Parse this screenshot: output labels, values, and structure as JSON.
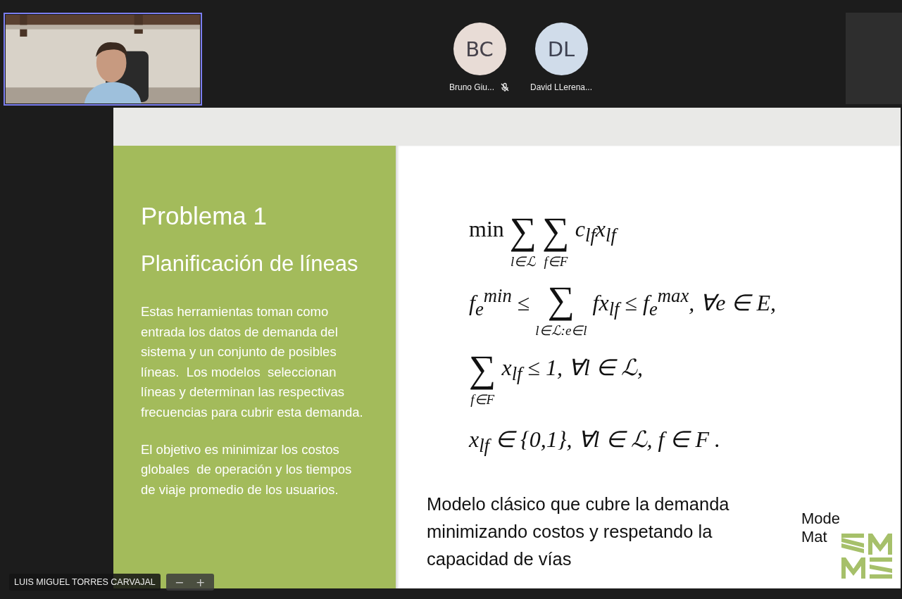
{
  "self_view": {
    "kind": "picture",
    "speaking": true
  },
  "participants": [
    {
      "initials": "BC",
      "name": "Bruno Giu...",
      "muted": true,
      "color": "#e8dcd6"
    },
    {
      "initials": "DL",
      "name": "David LLerena...",
      "muted": false,
      "color": "#d0dcea"
    }
  ],
  "slide": {
    "title": "Problema 1",
    "subtitle": "Planificación de líneas",
    "paragraphs": [
      "Estas herramientas toman como entrada los datos de demanda del sistema y un conjunto de posibles líneas.  Los modelos  seleccionan líneas y determinan las respectivas frecuencias para cubrir esta demanda.",
      "El objetivo es minimizar los costos globales  de operación y los tiempos de viaje promedio de los usuarios."
    ],
    "formulas": [
      [
        {
          "kind": "op",
          "text": "min"
        },
        {
          "kind": "sum",
          "symbol": "∑",
          "under": "l∈ℒ"
        },
        {
          "kind": "sum",
          "symbol": "∑",
          "under": "f∈F"
        },
        {
          "kind": "text",
          "text": "c$_{lf}$x$_{lf}$"
        }
      ],
      [
        {
          "kind": "text",
          "text": "f$_{e}$$^{min}$ ≤"
        },
        {
          "kind": "sum",
          "symbol": "∑",
          "under": "l∈ℒ:e∈l"
        },
        {
          "kind": "text",
          "text": "fx$_{lf}$ ≤ f$_{e}$$^{max}$, ∀e ∈ E,"
        }
      ],
      [
        {
          "kind": "sum",
          "symbol": "∑",
          "under": "f∈F"
        },
        {
          "kind": "text",
          "text": "x$_{lf}$ ≤ 1, ∀l ∈ ℒ,"
        }
      ],
      [
        {
          "kind": "text",
          "text": "x$_{lf}$ ∈ {0,1}, ∀l ∈ ℒ, f ∈ F ."
        }
      ]
    ],
    "caption": "Modelo clásico que cubre la demanda minimizando costos y respetando la capacidad de vías",
    "logo": {
      "line_1": "Mode",
      "line_2": "Mat"
    }
  },
  "name_label": "LUIS MIGUEL TORRES CARVAJAL",
  "zoom_buttons": [
    "−",
    "+"
  ]
}
